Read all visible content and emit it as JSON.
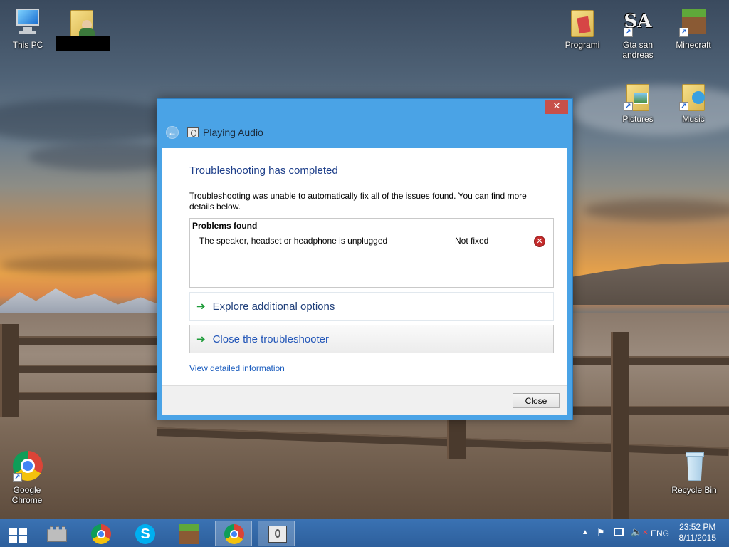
{
  "desktop": {
    "icons_left": [
      {
        "label": "This PC",
        "icon": "this-pc-icon"
      },
      {
        "label": "",
        "icon": "user-folder-icon"
      }
    ],
    "icons_right": [
      {
        "label": "Programi",
        "icon": "folder-icon"
      },
      {
        "label": "Gta san andreas",
        "icon": "gta-sa-icon"
      },
      {
        "label": "Minecraft",
        "icon": "minecraft-icon"
      },
      {
        "label": "Pictures",
        "icon": "pictures-folder-icon"
      },
      {
        "label": "Music",
        "icon": "music-folder-icon"
      }
    ],
    "chrome": {
      "label": "Google Chrome",
      "icon": "chrome-icon"
    },
    "recycle": {
      "label": "Recycle Bin",
      "icon": "recycle-bin-icon"
    }
  },
  "dialog": {
    "window_title": "Playing Audio",
    "close_glyph": "✕",
    "heading": "Troubleshooting has completed",
    "description": "Troubleshooting was unable to automatically fix all of the issues found. You can find more details below.",
    "problems_header": "Problems found",
    "problems": [
      {
        "text": "The speaker, headset or headphone is unplugged",
        "status": "Not fixed",
        "status_icon": "error-icon"
      }
    ],
    "options": [
      {
        "label": "Explore additional options"
      },
      {
        "label": "Close the troubleshooter"
      }
    ],
    "details_link": "View detailed information",
    "close_button": "Close"
  },
  "taskbar": {
    "items": [
      "start-button",
      "castle-icon",
      "chrome-icon",
      "skype-icon",
      "minecraft-icon",
      "chrome-icon",
      "troubleshooter-icon"
    ],
    "tray": {
      "language": "ENG",
      "time": "23:52 PM",
      "date": "8/11/2015"
    }
  },
  "colors": {
    "accent": "#4aa3e6",
    "heading_blue": "#1e3f8a",
    "link_blue": "#1e5fbf",
    "error_red": "#c42b2b",
    "taskbar": "#2d5f9c"
  }
}
